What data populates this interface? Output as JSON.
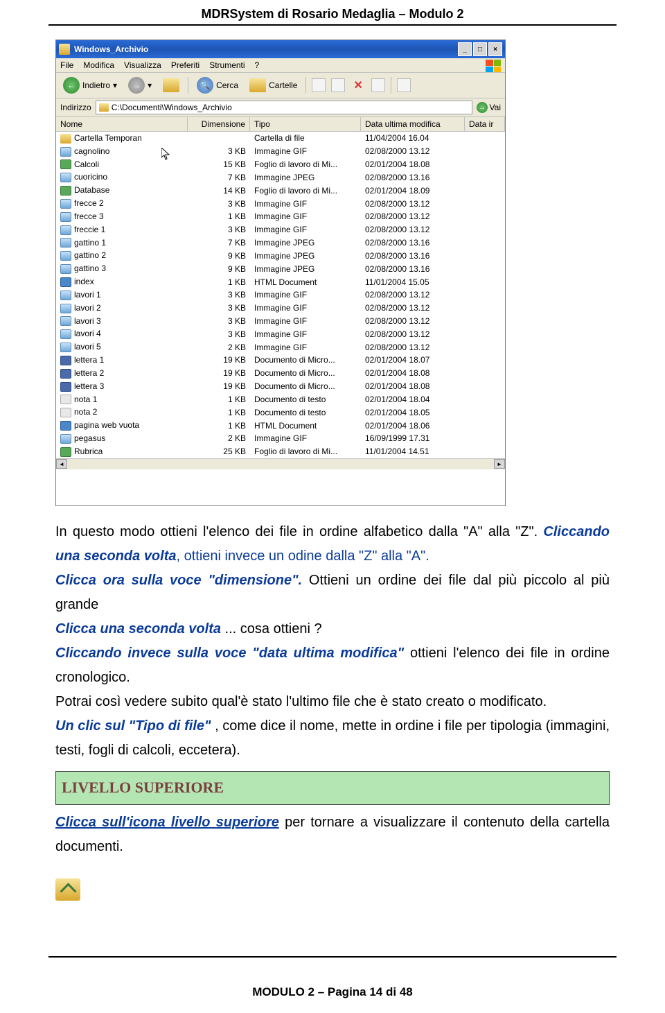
{
  "header": {
    "title": "MDRSystem di Rosario Medaglia – Modulo 2"
  },
  "window": {
    "title": "Windows_Archivio",
    "menu": [
      "File",
      "Modifica",
      "Visualizza",
      "Preferiti",
      "Strumenti",
      "?"
    ],
    "toolbar": {
      "back": "Indietro",
      "search": "Cerca",
      "folders": "Cartelle"
    },
    "address": {
      "label": "Indirizzo",
      "path": "C:\\Documenti\\Windows_Archivio",
      "go": "Vai"
    },
    "columns": {
      "name": "Nome",
      "size": "Dimensione",
      "type": "Tipo",
      "date": "Data ultima modifica",
      "extra": "Data ir"
    },
    "rows": [
      {
        "icon": "folder",
        "name": "Cartella Temporan",
        "size": "",
        "type": "Cartella di file",
        "date": "11/04/2004 16.04"
      },
      {
        "icon": "gif",
        "name": "cagnolino",
        "size": "3 KB",
        "type": "Immagine GIF",
        "date": "02/08/2000 13.12"
      },
      {
        "icon": "xls",
        "name": "Calcoli",
        "size": "15 KB",
        "type": "Foglio di lavoro di Mi...",
        "date": "02/01/2004 18.08"
      },
      {
        "icon": "jpeg",
        "name": "cuoricino",
        "size": "7 KB",
        "type": "Immagine JPEG",
        "date": "02/08/2000 13.16"
      },
      {
        "icon": "xls",
        "name": "Database",
        "size": "14 KB",
        "type": "Foglio di lavoro di Mi...",
        "date": "02/01/2004 18.09"
      },
      {
        "icon": "gif",
        "name": "frecce 2",
        "size": "3 KB",
        "type": "Immagine GIF",
        "date": "02/08/2000 13.12"
      },
      {
        "icon": "gif",
        "name": "frecce 3",
        "size": "1 KB",
        "type": "Immagine GIF",
        "date": "02/08/2000 13.12"
      },
      {
        "icon": "gif",
        "name": "freccie 1",
        "size": "3 KB",
        "type": "Immagine GIF",
        "date": "02/08/2000 13.12"
      },
      {
        "icon": "jpeg",
        "name": "gattino 1",
        "size": "7 KB",
        "type": "Immagine JPEG",
        "date": "02/08/2000 13.16"
      },
      {
        "icon": "jpeg",
        "name": "gattino 2",
        "size": "9 KB",
        "type": "Immagine JPEG",
        "date": "02/08/2000 13.16"
      },
      {
        "icon": "jpeg",
        "name": "gattino 3",
        "size": "9 KB",
        "type": "Immagine JPEG",
        "date": "02/08/2000 13.16"
      },
      {
        "icon": "html",
        "name": "index",
        "size": "1 KB",
        "type": "HTML Document",
        "date": "11/01/2004 15.05"
      },
      {
        "icon": "gif",
        "name": "lavori 1",
        "size": "3 KB",
        "type": "Immagine GIF",
        "date": "02/08/2000 13.12"
      },
      {
        "icon": "gif",
        "name": "lavori 2",
        "size": "3 KB",
        "type": "Immagine GIF",
        "date": "02/08/2000 13.12"
      },
      {
        "icon": "gif",
        "name": "lavori 3",
        "size": "3 KB",
        "type": "Immagine GIF",
        "date": "02/08/2000 13.12"
      },
      {
        "icon": "gif",
        "name": "lavori 4",
        "size": "3 KB",
        "type": "Immagine GIF",
        "date": "02/08/2000 13.12"
      },
      {
        "icon": "gif",
        "name": "lavori 5",
        "size": "2 KB",
        "type": "Immagine GIF",
        "date": "02/08/2000 13.12"
      },
      {
        "icon": "doc",
        "name": "lettera 1",
        "size": "19 KB",
        "type": "Documento di Micro...",
        "date": "02/01/2004 18.07"
      },
      {
        "icon": "doc",
        "name": "lettera 2",
        "size": "19 KB",
        "type": "Documento di Micro...",
        "date": "02/01/2004 18.08"
      },
      {
        "icon": "doc",
        "name": "lettera 3",
        "size": "19 KB",
        "type": "Documento di Micro...",
        "date": "02/01/2004 18.08"
      },
      {
        "icon": "txt",
        "name": "nota 1",
        "size": "1 KB",
        "type": "Documento di testo",
        "date": "02/01/2004 18.04"
      },
      {
        "icon": "txt",
        "name": "nota 2",
        "size": "1 KB",
        "type": "Documento di testo",
        "date": "02/01/2004 18.05"
      },
      {
        "icon": "html",
        "name": "pagina web vuota",
        "size": "1 KB",
        "type": "HTML Document",
        "date": "02/01/2004 18.06"
      },
      {
        "icon": "gif",
        "name": "pegasus",
        "size": "2 KB",
        "type": "Immagine GIF",
        "date": "16/09/1999 17.31"
      },
      {
        "icon": "xls",
        "name": "Rubrica",
        "size": "25 KB",
        "type": "Foglio di lavoro di Mi...",
        "date": "11/01/2004 14.51"
      }
    ]
  },
  "body": {
    "p1_a": "In questo modo ottieni l'elenco dei file in ordine alfabetico dalla \"A\" alla \"Z\".",
    "p1_b": "Cliccando una seconda volta",
    "p1_c": ", ottieni invece un odine dalla \"Z\" alla \"A\".",
    "p2_a": "Clicca ora sulla voce \"dimensione\".",
    "p2_b": " Ottieni un ordine dei file dal più piccolo al più grande",
    "p3_a": "Clicca una seconda volta",
    "p3_b": " ... cosa ottieni ?",
    "p4_a": "Cliccando invece sulla voce \"data ultima modifica\"",
    "p4_b": " ottieni l'elenco dei file in ordine cronologico.",
    "p5": "Potrai così vedere subito qual'è stato l'ultimo file che è stato creato o modificato.",
    "p6_a": "Un clic sul \"Tipo di file\"",
    "p6_b": " , come dice il nome, mette in ordine i file per tipologia (immagini, testi, fogli di calcoli, eccetera).",
    "heading": "LIVELLO SUPERIORE",
    "p7_a": "Clicca sull'icona livello superiore",
    "p7_b": " per tornare a visualizzare il contenuto della cartella documenti."
  },
  "footer": {
    "text": "MODULO 2 – Pagina 14 di 48"
  }
}
